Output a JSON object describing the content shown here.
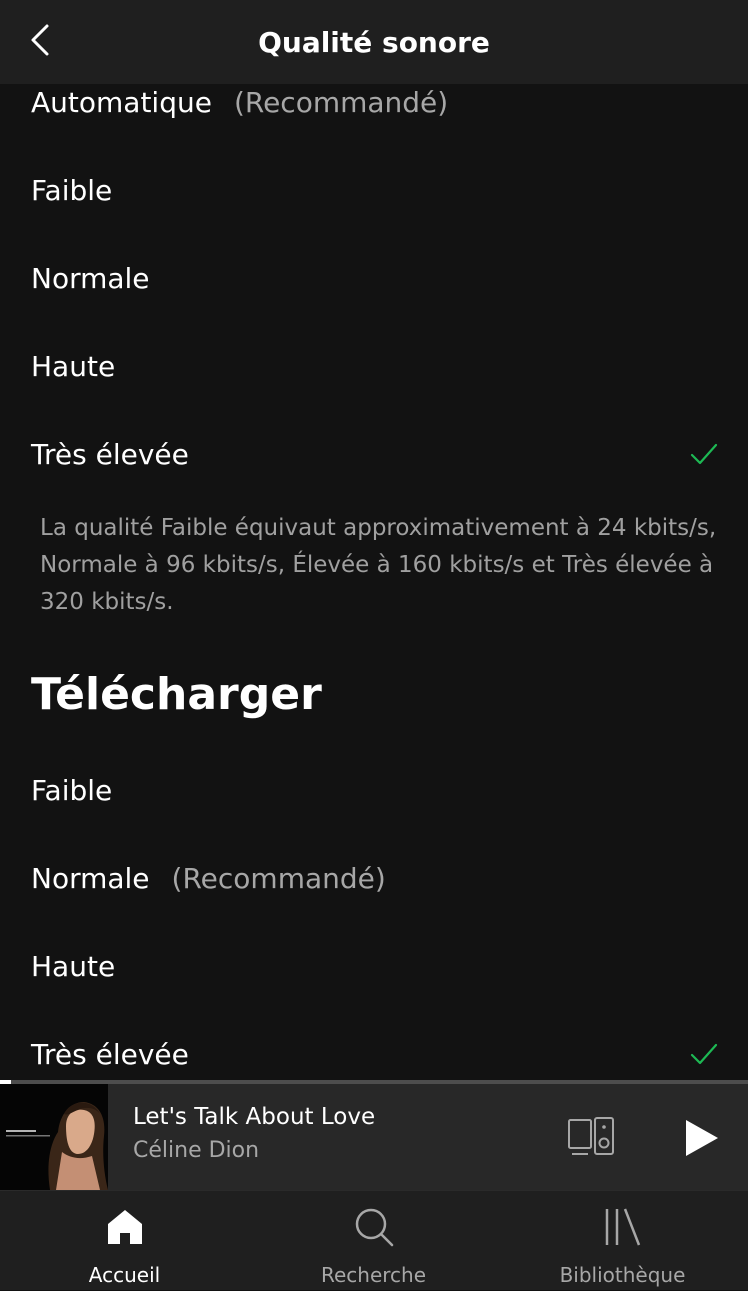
{
  "header": {
    "title": "Qualité sonore",
    "back_icon": "chevron-left-icon"
  },
  "streaming": {
    "options": [
      {
        "label": "Automatique",
        "sub": "(Recommandé)",
        "selected": false
      },
      {
        "label": "Faible",
        "sub": "",
        "selected": false
      },
      {
        "label": "Normale",
        "sub": "",
        "selected": false
      },
      {
        "label": "Haute",
        "sub": "",
        "selected": false
      },
      {
        "label": "Très élevée",
        "sub": "",
        "selected": true
      }
    ],
    "note": "La qualité Faible équivaut approximativement à 24 kbits/s, Normale à 96 kbits/s, Élevée à 160 kbits/s et Très élevée à 320 kbits/s."
  },
  "download": {
    "title": "Télécharger",
    "options": [
      {
        "label": "Faible",
        "sub": "",
        "selected": false
      },
      {
        "label": "Normale",
        "sub": "(Recommandé)",
        "selected": false
      },
      {
        "label": "Haute",
        "sub": "",
        "selected": false
      },
      {
        "label": "Très élevée",
        "sub": "",
        "selected": true
      }
    ]
  },
  "player": {
    "track": "Let's Talk About Love",
    "artist": "Céline Dion",
    "progress": 0.015,
    "devices_icon": "devices-icon",
    "play_icon": "play-icon"
  },
  "tabs": [
    {
      "label": "Accueil",
      "icon": "home-icon",
      "active": true
    },
    {
      "label": "Recherche",
      "icon": "search-icon",
      "active": false
    },
    {
      "label": "Bibliothèque",
      "icon": "library-icon",
      "active": false
    }
  ],
  "colors": {
    "accent": "#1db954",
    "background": "#121212",
    "header": "#1f1f1f",
    "player": "#282828",
    "secondary_text": "#a7a7a7"
  }
}
